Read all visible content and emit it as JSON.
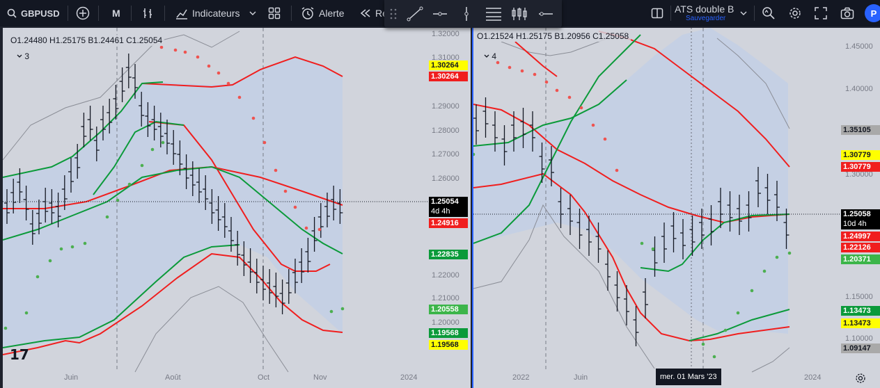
{
  "toolbar": {
    "symbol": "GBPUSD",
    "interval": "M",
    "indicators_label": "Indicateurs",
    "alert_label": "Alerte",
    "replay_label": "Re",
    "layout_name": "ATS double B",
    "layout_sub": "Sauvegarder",
    "avatar_letter": "P"
  },
  "colors": {
    "red": "#f01e1e",
    "green": "#0b9a3a",
    "bg": "#d1d4dc",
    "band_fill": "#c5d0e4",
    "blue": "#2962ff"
  },
  "left_pane": {
    "ohlc": "O1.24480  H1.25175  B1.24461  C1.25054",
    "collapse_count": "3",
    "price_axis": [
      "1.32000",
      "1.31000",
      "1.29000",
      "1.28000",
      "1.27000",
      "1.26000",
      "1.22000",
      "1.21000",
      "1.20000"
    ],
    "time_axis": [
      "Juin",
      "Août",
      "Oct",
      "Nov",
      "2024"
    ],
    "tags": {
      "t1": "1.30264",
      "t2": "1.30264",
      "cur": "1.25054",
      "cur_sub": "4d 4h",
      "t3": "1.24916",
      "t4": "1.22835",
      "t5": "1.20558",
      "t6": "1.19568",
      "t7": "1.19568"
    },
    "logo": "17"
  },
  "right_pane": {
    "ohlc": "O1.21524  H1.25175  B1.20956  C1.25058",
    "collapse_count": "4",
    "price_axis": [
      "1.45000",
      "1.40000",
      "1.30000",
      "1.15000",
      "1.10000"
    ],
    "time_axis": [
      "2022",
      "Juin",
      "2024"
    ],
    "tags": {
      "t1": "1.35105",
      "t2": "1.30779",
      "t3": "1.30779",
      "cur": "1.25058",
      "cur_sub": "10d 4h",
      "t4": "1.24997",
      "t5": "1.22126",
      "t6": "1.20371",
      "t7": "1.13473",
      "t8": "1.13473",
      "t9": "1.09147"
    },
    "crosshair_date": "mer. 01 Mars '23"
  }
}
